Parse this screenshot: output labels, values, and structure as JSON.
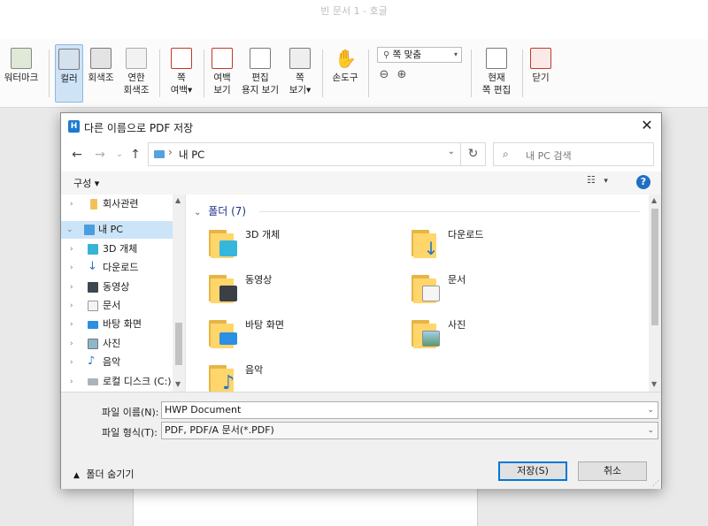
{
  "app": {
    "title": "빈 문서 1 - 호글"
  },
  "ribbon": {
    "items": [
      {
        "label": "워터마크"
      },
      {
        "label": "컬러"
      },
      {
        "label": "회색조"
      },
      {
        "label": "연한\n회색조"
      },
      {
        "label": "쪽\n여백▾"
      },
      {
        "label": "여백\n보기"
      },
      {
        "label": "편집\n용지 보기"
      },
      {
        "label": "쪽\n보기▾"
      },
      {
        "label": "손도구"
      },
      {
        "label": "현재\n쪽 편집"
      },
      {
        "label": "닫기"
      }
    ],
    "zoom_select": "쪽 맞춤",
    "zoom_out_icon": "zoom-out-icon",
    "zoom_in_icon": "zoom-in-icon"
  },
  "dialog": {
    "title": "다른 이름으로 PDF 저장",
    "close": "✕",
    "address": {
      "location": "내 PC"
    },
    "search": {
      "placeholder": "내 PC 검색"
    },
    "organize": "구성 ▾",
    "help": "?",
    "nav_items": [
      {
        "label": "회사관련",
        "icon": "folder-icon"
      },
      {
        "label": "내 PC",
        "icon": "pc-icon",
        "selected": true
      },
      {
        "label": "3D 개체",
        "icon": "3d-objects-icon"
      },
      {
        "label": "다운로드",
        "icon": "download-icon"
      },
      {
        "label": "동영상",
        "icon": "video-icon"
      },
      {
        "label": "문서",
        "icon": "document-icon"
      },
      {
        "label": "바탕 화면",
        "icon": "desktop-icon"
      },
      {
        "label": "사진",
        "icon": "picture-icon"
      },
      {
        "label": "음악",
        "icon": "music-icon"
      },
      {
        "label": "로컬 디스크 (C:)",
        "icon": "drive-icon"
      }
    ],
    "group_header": "폴더 (7)",
    "folders": [
      {
        "name": "3D 개체",
        "icon": "3d-objects-folder-icon"
      },
      {
        "name": "다운로드",
        "icon": "downloads-folder-icon"
      },
      {
        "name": "동영상",
        "icon": "videos-folder-icon"
      },
      {
        "name": "문서",
        "icon": "documents-folder-icon"
      },
      {
        "name": "바탕 화면",
        "icon": "desktop-folder-icon"
      },
      {
        "name": "사진",
        "icon": "pictures-folder-icon"
      },
      {
        "name": "음악",
        "icon": "music-folder-icon"
      }
    ],
    "filename_label": "파일 이름(N):",
    "filename_value": "HWP Document",
    "filetype_label": "파일 형식(T):",
    "filetype_value": "PDF, PDF/A 문서(*.PDF)",
    "hide_folders": "폴더 숨기기",
    "save_button": "저장(S)",
    "cancel_button": "취소"
  }
}
